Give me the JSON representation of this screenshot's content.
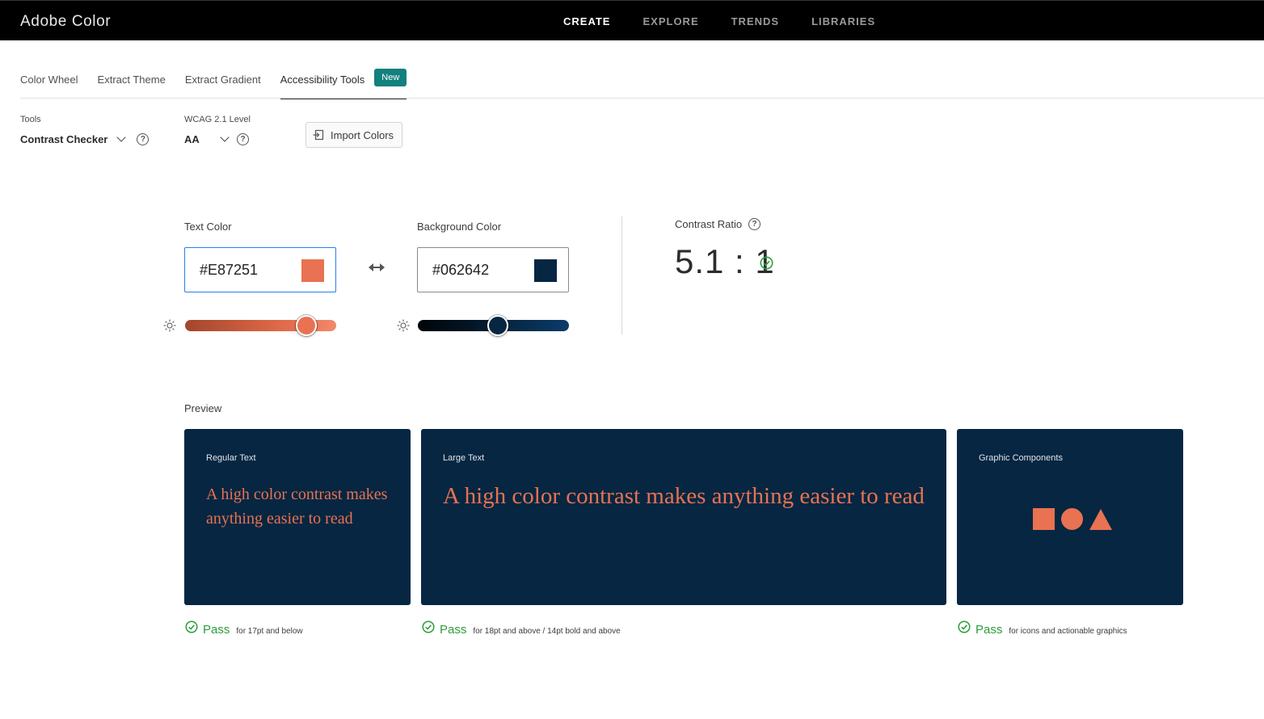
{
  "app": {
    "title": "Adobe Color"
  },
  "nav": [
    {
      "label": "CREATE",
      "active": true
    },
    {
      "label": "EXPLORE",
      "active": false
    },
    {
      "label": "TRENDS",
      "active": false
    },
    {
      "label": "LIBRARIES",
      "active": false
    }
  ],
  "tabs": [
    {
      "label": "Color Wheel"
    },
    {
      "label": "Extract Theme"
    },
    {
      "label": "Extract Gradient"
    },
    {
      "label": "Accessibility Tools",
      "active": true,
      "badge": "New"
    }
  ],
  "tools": {
    "tool_label": "Tools",
    "tool_value": "Contrast Checker",
    "wcag_label": "WCAG 2.1 Level",
    "wcag_value": "AA",
    "import_label": "Import Colors"
  },
  "text_color": {
    "label": "Text Color",
    "hex": "#E87251",
    "brightness_fraction": 0.8
  },
  "background_color": {
    "label": "Background Color",
    "hex": "#062642",
    "brightness_fraction": 0.53
  },
  "contrast": {
    "label": "Contrast Ratio",
    "value": "5.1 : 1"
  },
  "preview": {
    "label": "Preview",
    "regular": {
      "title": "Regular Text",
      "sample": "A high color contrast makes anything easier to read",
      "result": "Pass",
      "note": "for 17pt and below"
    },
    "large": {
      "title": "Large Text",
      "sample": "A high color contrast makes anything easier to read",
      "result": "Pass",
      "note": "for 18pt and above / 14pt bold and above"
    },
    "graphic": {
      "title": "Graphic Components",
      "result": "Pass",
      "note": "for icons and actionable graphics"
    }
  },
  "colors": {
    "accent_new_badge": "#12807d",
    "pass_green": "#2d9d3a"
  }
}
